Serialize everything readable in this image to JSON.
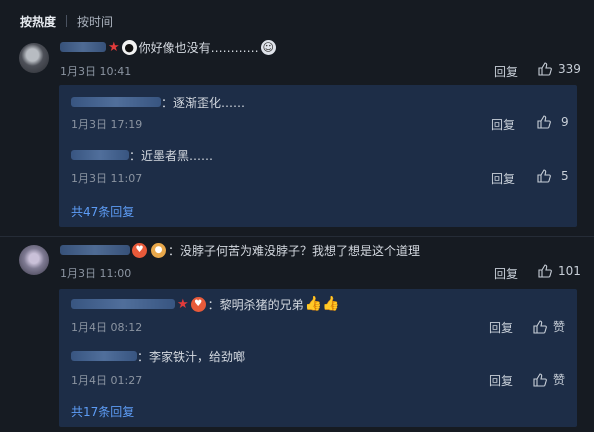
{
  "sort": {
    "hot": "按热度",
    "time": "按时间"
  },
  "comments": [
    {
      "text": "你好像也没有…………",
      "date": "1月3日 10:41",
      "reply_label": "回复",
      "likes": "339",
      "replies": [
        {
          "text": "逐渐歪化……",
          "date": "1月3日 17:19",
          "reply_label": "回复",
          "likes": "9"
        },
        {
          "text": "近墨者黑……",
          "date": "1月3日 11:07",
          "reply_label": "回复",
          "likes": "5"
        }
      ],
      "more": "共47条回复"
    },
    {
      "text": "没脖子何苦为难没脖子？我想了想是这个道理",
      "date": "1月3日 11:00",
      "reply_label": "回复",
      "likes": "101",
      "replies": [
        {
          "text": "黎明杀猪的兄弟",
          "date": "1月4日 08:12",
          "reply_label": "回复",
          "likes": "赞"
        },
        {
          "text": "李家铁汁，给劲啷",
          "date": "1月4日 01:27",
          "reply_label": "回复",
          "likes": "赞"
        }
      ],
      "more": "共17条回复"
    }
  ],
  "icons": {
    "like": "thumbs-up-icon"
  },
  "colors": {
    "background": "#161b22",
    "reply_box": "#1d2d47",
    "link": "#5d9cf5",
    "star": "#e23b3b"
  }
}
